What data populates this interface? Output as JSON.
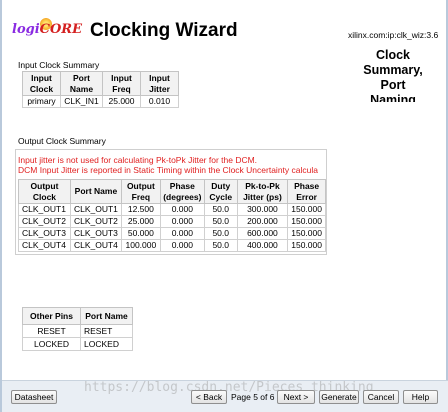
{
  "header": {
    "logo_text_a": "logi",
    "logo_text_b": "CORE",
    "title": "Clocking Wizard",
    "ip_identifier": "xilinx.com:ip:clk_wiz:3.6",
    "side_title": "Clock Summary, Port Naming"
  },
  "input_summary": {
    "label": "Input Clock Summary",
    "columns": [
      "Input Clock",
      "Port Name",
      "Input Freq",
      "Input Jitter"
    ],
    "rows": [
      [
        "primary",
        "CLK_IN1",
        "25.000",
        "0.010"
      ]
    ]
  },
  "output_summary": {
    "label": "Output Clock Summary",
    "note_1": "Input jitter is not used for calculating Pk-toPk Jitter for the DCM.",
    "note_2": "DCM Input Jitter is reported in Static Timing within the Clock Uncertainty calcula",
    "columns": [
      "Output Clock",
      "Port Name",
      "Output Freq",
      "Phase (degrees)",
      "Duty Cycle",
      "Pk-to-Pk Jitter (ps)",
      "Phase Error"
    ],
    "rows": [
      [
        "CLK_OUT1",
        "CLK_OUT1",
        "12.500",
        "0.000",
        "50.0",
        "300.000",
        "150.000"
      ],
      [
        "CLK_OUT2",
        "CLK_OUT2",
        "25.000",
        "0.000",
        "50.0",
        "200.000",
        "150.000"
      ],
      [
        "CLK_OUT3",
        "CLK_OUT3",
        "50.000",
        "0.000",
        "50.0",
        "600.000",
        "150.000"
      ],
      [
        "CLK_OUT4",
        "CLK_OUT4",
        "100.000",
        "0.000",
        "50.0",
        "400.000",
        "150.000"
      ]
    ]
  },
  "other_pins": {
    "columns": [
      "Other Pins",
      "Port Name"
    ],
    "rows": [
      [
        "RESET",
        "RESET"
      ],
      [
        "LOCKED",
        "LOCKED"
      ]
    ]
  },
  "footer": {
    "datasheet_label": "Datasheet",
    "back_label": "< Back",
    "page_indicator": "Page 5 of 6",
    "next_label": "Next >",
    "generate_label": "Generate",
    "cancel_label": "Cancel",
    "help_label": "Help",
    "watermark": "https://blog.csdn.net/Pieces_thinking"
  }
}
